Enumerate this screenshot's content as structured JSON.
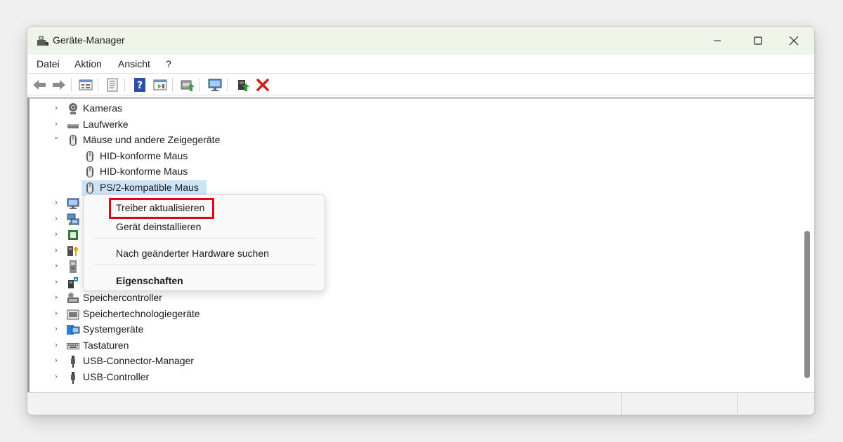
{
  "window": {
    "title": "Geräte-Manager"
  },
  "menubar": {
    "items": [
      "Datei",
      "Aktion",
      "Ansicht",
      "?"
    ]
  },
  "toolbar": {
    "icons": [
      "back-arrow-icon",
      "forward-arrow-icon",
      "properties-view-icon",
      "document-icon",
      "help-icon",
      "action-view-icon",
      "update-driver-icon",
      "monitor-icon",
      "enable-device-icon",
      "uninstall-device-icon"
    ],
    "accent_uninstall": "#d11a1a"
  },
  "tree": {
    "rows": [
      {
        "label": "Kameras",
        "icon": "camera-icon",
        "expanded": false
      },
      {
        "label": "Laufwerke",
        "icon": "drive-icon",
        "expanded": false
      },
      {
        "label": "Mäuse und andere Zeigegeräte",
        "icon": "mouse-icon",
        "expanded": true
      },
      {
        "label": "HID-konforme Maus",
        "icon": "mouse-icon",
        "child": true
      },
      {
        "label": "HID-konforme Maus",
        "icon": "mouse-icon",
        "child": true
      },
      {
        "label": "PS/2-kompatible Maus",
        "icon": "mouse-icon",
        "child": true,
        "selected": true
      },
      {
        "label": "",
        "icon": "monitor-icon",
        "expanded": false
      },
      {
        "label": "",
        "icon": "network-icon",
        "expanded": false
      },
      {
        "label": "",
        "icon": "processor-icon",
        "expanded": false
      },
      {
        "label": "",
        "icon": "security-device-icon",
        "expanded": false
      },
      {
        "label": "",
        "icon": "software-component-icon",
        "expanded": false
      },
      {
        "label": "",
        "icon": "software-device-icon",
        "expanded": false
      },
      {
        "label": "Speichercontroller",
        "icon": "storage-controller-icon",
        "expanded": false
      },
      {
        "label": "Speichertechnologiegeräte",
        "icon": "storage-technology-icon",
        "expanded": false
      },
      {
        "label": "Systemgeräte",
        "icon": "system-devices-icon",
        "expanded": false
      },
      {
        "label": "Tastaturen",
        "icon": "keyboard-icon",
        "expanded": false
      },
      {
        "label": "USB-Connector-Manager",
        "icon": "usb-icon",
        "expanded": false
      },
      {
        "label": "USB-Controller",
        "icon": "usb-icon",
        "expanded": false
      }
    ],
    "selection_color": "#cce4f7"
  },
  "context_menu": {
    "update_driver": "Treiber aktualisieren",
    "uninstall_device": "Gerät deinstallieren",
    "scan_hardware": "Nach geänderter Hardware suchen",
    "properties": "Eigenschaften",
    "highlight_color": "#e3001b"
  }
}
